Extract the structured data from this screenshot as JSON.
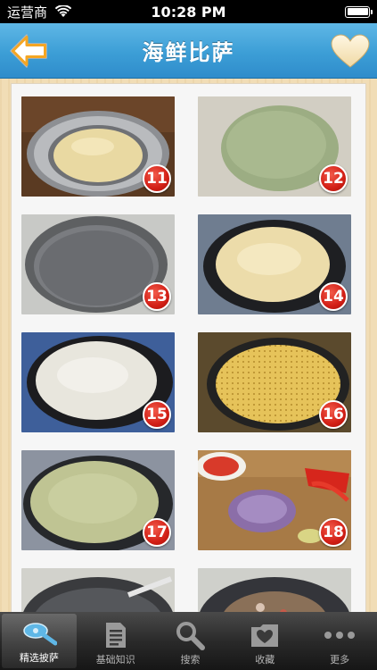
{
  "status_bar": {
    "carrier": "运营商",
    "time": "10:28 PM"
  },
  "nav": {
    "title": "海鲜比萨"
  },
  "steps": [
    {
      "number": "11",
      "photo": "dough-ball-in-bowl"
    },
    {
      "number": "12",
      "photo": "green-dough-sheet"
    },
    {
      "number": "13",
      "photo": "empty-pizza-pan"
    },
    {
      "number": "14",
      "photo": "dough-in-pan"
    },
    {
      "number": "15",
      "photo": "dough-spread-in-pan"
    },
    {
      "number": "16",
      "photo": "docked-dough-in-pan"
    },
    {
      "number": "17",
      "photo": "green-dough-in-pan"
    },
    {
      "number": "18",
      "photo": "chopped-vegetables"
    }
  ],
  "tab_bar": {
    "items": [
      {
        "label": "精选披萨",
        "icon": "pizza-cutter-icon",
        "active": true
      },
      {
        "label": "基础知识",
        "icon": "document-icon",
        "active": false
      },
      {
        "label": "搜索",
        "icon": "search-icon",
        "active": false
      },
      {
        "label": "收藏",
        "icon": "heart-folder-icon",
        "active": false
      },
      {
        "label": "更多",
        "icon": "more-icon",
        "active": false
      }
    ]
  },
  "colors": {
    "nav_blue": "#3c9ed6",
    "badge_red": "#d21f16",
    "background_wood": "#f1ddb6"
  }
}
